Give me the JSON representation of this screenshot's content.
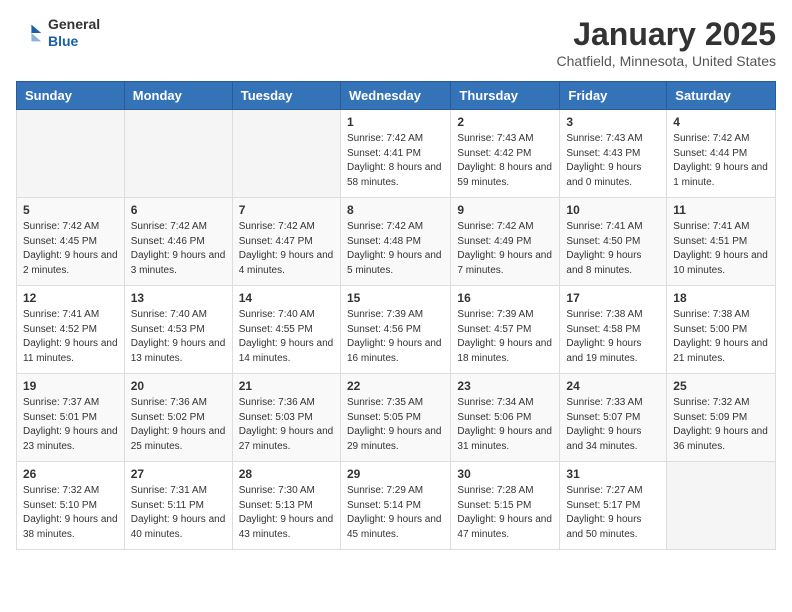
{
  "header": {
    "logo_line1": "General",
    "logo_line2": "Blue",
    "month": "January 2025",
    "location": "Chatfield, Minnesota, United States"
  },
  "weekdays": [
    "Sunday",
    "Monday",
    "Tuesday",
    "Wednesday",
    "Thursday",
    "Friday",
    "Saturday"
  ],
  "weeks": [
    [
      {
        "day": "",
        "info": ""
      },
      {
        "day": "",
        "info": ""
      },
      {
        "day": "",
        "info": ""
      },
      {
        "day": "1",
        "info": "Sunrise: 7:42 AM\nSunset: 4:41 PM\nDaylight: 8 hours and 58 minutes."
      },
      {
        "day": "2",
        "info": "Sunrise: 7:43 AM\nSunset: 4:42 PM\nDaylight: 8 hours and 59 minutes."
      },
      {
        "day": "3",
        "info": "Sunrise: 7:43 AM\nSunset: 4:43 PM\nDaylight: 9 hours and 0 minutes."
      },
      {
        "day": "4",
        "info": "Sunrise: 7:42 AM\nSunset: 4:44 PM\nDaylight: 9 hours and 1 minute."
      }
    ],
    [
      {
        "day": "5",
        "info": "Sunrise: 7:42 AM\nSunset: 4:45 PM\nDaylight: 9 hours and 2 minutes."
      },
      {
        "day": "6",
        "info": "Sunrise: 7:42 AM\nSunset: 4:46 PM\nDaylight: 9 hours and 3 minutes."
      },
      {
        "day": "7",
        "info": "Sunrise: 7:42 AM\nSunset: 4:47 PM\nDaylight: 9 hours and 4 minutes."
      },
      {
        "day": "8",
        "info": "Sunrise: 7:42 AM\nSunset: 4:48 PM\nDaylight: 9 hours and 5 minutes."
      },
      {
        "day": "9",
        "info": "Sunrise: 7:42 AM\nSunset: 4:49 PM\nDaylight: 9 hours and 7 minutes."
      },
      {
        "day": "10",
        "info": "Sunrise: 7:41 AM\nSunset: 4:50 PM\nDaylight: 9 hours and 8 minutes."
      },
      {
        "day": "11",
        "info": "Sunrise: 7:41 AM\nSunset: 4:51 PM\nDaylight: 9 hours and 10 minutes."
      }
    ],
    [
      {
        "day": "12",
        "info": "Sunrise: 7:41 AM\nSunset: 4:52 PM\nDaylight: 9 hours and 11 minutes."
      },
      {
        "day": "13",
        "info": "Sunrise: 7:40 AM\nSunset: 4:53 PM\nDaylight: 9 hours and 13 minutes."
      },
      {
        "day": "14",
        "info": "Sunrise: 7:40 AM\nSunset: 4:55 PM\nDaylight: 9 hours and 14 minutes."
      },
      {
        "day": "15",
        "info": "Sunrise: 7:39 AM\nSunset: 4:56 PM\nDaylight: 9 hours and 16 minutes."
      },
      {
        "day": "16",
        "info": "Sunrise: 7:39 AM\nSunset: 4:57 PM\nDaylight: 9 hours and 18 minutes."
      },
      {
        "day": "17",
        "info": "Sunrise: 7:38 AM\nSunset: 4:58 PM\nDaylight: 9 hours and 19 minutes."
      },
      {
        "day": "18",
        "info": "Sunrise: 7:38 AM\nSunset: 5:00 PM\nDaylight: 9 hours and 21 minutes."
      }
    ],
    [
      {
        "day": "19",
        "info": "Sunrise: 7:37 AM\nSunset: 5:01 PM\nDaylight: 9 hours and 23 minutes."
      },
      {
        "day": "20",
        "info": "Sunrise: 7:36 AM\nSunset: 5:02 PM\nDaylight: 9 hours and 25 minutes."
      },
      {
        "day": "21",
        "info": "Sunrise: 7:36 AM\nSunset: 5:03 PM\nDaylight: 9 hours and 27 minutes."
      },
      {
        "day": "22",
        "info": "Sunrise: 7:35 AM\nSunset: 5:05 PM\nDaylight: 9 hours and 29 minutes."
      },
      {
        "day": "23",
        "info": "Sunrise: 7:34 AM\nSunset: 5:06 PM\nDaylight: 9 hours and 31 minutes."
      },
      {
        "day": "24",
        "info": "Sunrise: 7:33 AM\nSunset: 5:07 PM\nDaylight: 9 hours and 34 minutes."
      },
      {
        "day": "25",
        "info": "Sunrise: 7:32 AM\nSunset: 5:09 PM\nDaylight: 9 hours and 36 minutes."
      }
    ],
    [
      {
        "day": "26",
        "info": "Sunrise: 7:32 AM\nSunset: 5:10 PM\nDaylight: 9 hours and 38 minutes."
      },
      {
        "day": "27",
        "info": "Sunrise: 7:31 AM\nSunset: 5:11 PM\nDaylight: 9 hours and 40 minutes."
      },
      {
        "day": "28",
        "info": "Sunrise: 7:30 AM\nSunset: 5:13 PM\nDaylight: 9 hours and 43 minutes."
      },
      {
        "day": "29",
        "info": "Sunrise: 7:29 AM\nSunset: 5:14 PM\nDaylight: 9 hours and 45 minutes."
      },
      {
        "day": "30",
        "info": "Sunrise: 7:28 AM\nSunset: 5:15 PM\nDaylight: 9 hours and 47 minutes."
      },
      {
        "day": "31",
        "info": "Sunrise: 7:27 AM\nSunset: 5:17 PM\nDaylight: 9 hours and 50 minutes."
      },
      {
        "day": "",
        "info": ""
      }
    ]
  ]
}
